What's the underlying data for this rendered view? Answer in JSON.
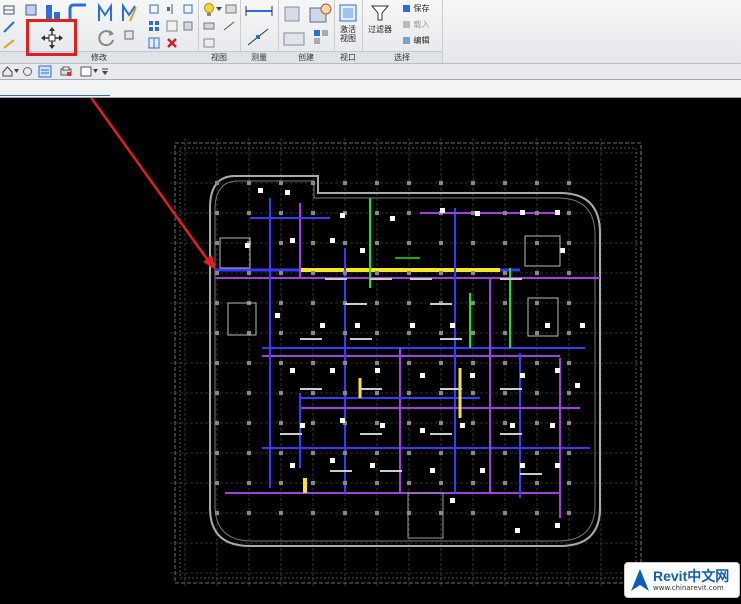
{
  "ribbon": {
    "panels": {
      "modify": "修改",
      "view": "视图",
      "measure": "测量",
      "create": "创建",
      "view_panel": "视口",
      "selection": "选择"
    },
    "buttons": {
      "activate_view_line1": "激活",
      "activate_view_line2": "视图",
      "filter": "过滤器",
      "save": "保存",
      "load": "载入",
      "edit": "编辑"
    }
  },
  "watermark": {
    "brand": "Revit中文网",
    "url": "www.chinarevit.com"
  },
  "colors": {
    "highlight": "#e02020",
    "duct_blue": "#3a3aff",
    "duct_purple": "#a040e0",
    "duct_yellow": "#f5e62a",
    "pipe_green": "#22e022"
  }
}
